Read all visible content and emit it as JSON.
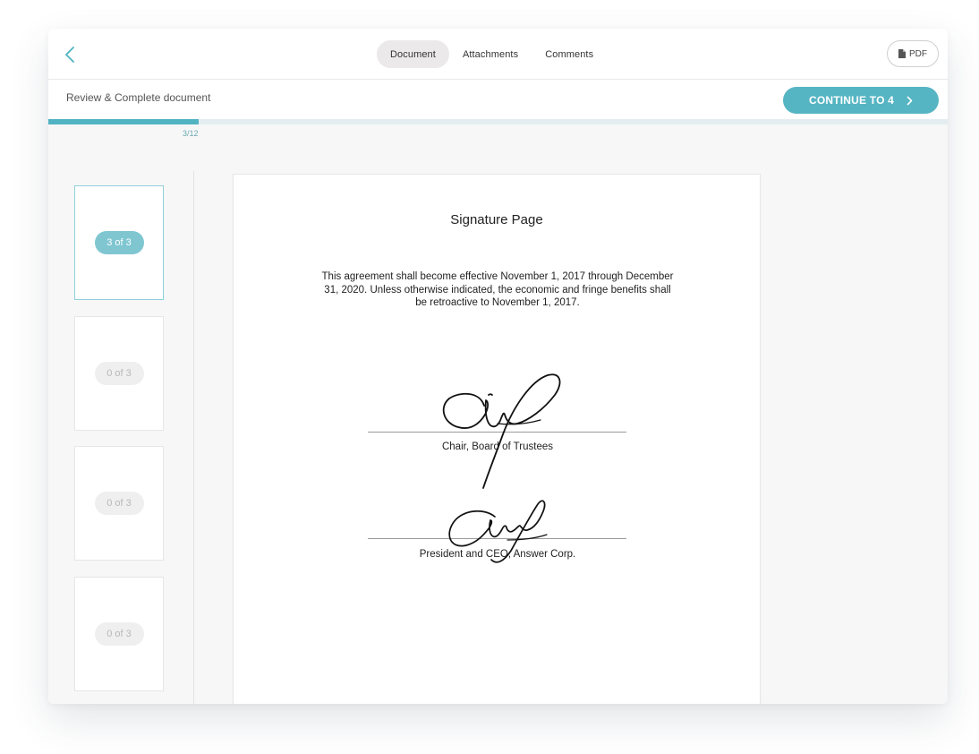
{
  "header": {
    "tabs": [
      {
        "label": "Document",
        "active": true
      },
      {
        "label": "Attachments",
        "active": false
      },
      {
        "label": "Comments",
        "active": false
      }
    ],
    "pdf_label": "PDF"
  },
  "subbar": {
    "title": "Review & Complete document",
    "continue_label": "CONTINUE TO 4"
  },
  "progress": {
    "label": "3/12",
    "fraction": 0.167
  },
  "thumbnails": [
    {
      "label": "3 of 3",
      "active": true
    },
    {
      "label": "0 of 3",
      "active": false
    },
    {
      "label": "0 of 3",
      "active": false
    },
    {
      "label": "0 of 3",
      "active": false
    }
  ],
  "document": {
    "title": "Signature Page",
    "body": "This agreement shall become effective November 1, 2017 through December 31, 2020. Unless otherwise indicated, the economic and fringe benefits shall be retroactive to November 1, 2017.",
    "signatures": [
      {
        "label": "Chair, Board of Trustees"
      },
      {
        "label": "President and CEO, Answer Corp."
      }
    ]
  },
  "colors": {
    "accent": "#56b5c3",
    "progress": "#52b3c2",
    "thumb_active": "#7fc6d1"
  }
}
